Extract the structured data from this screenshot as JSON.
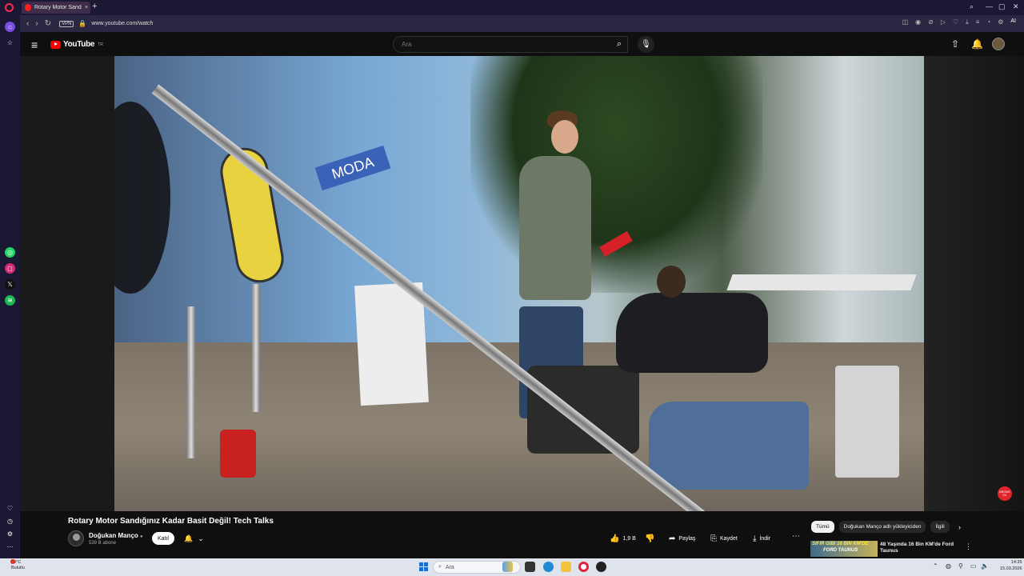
{
  "browser": {
    "tab_title": "Rotary Motor Sandığı",
    "tab_close": "×",
    "new_tab": "+",
    "url": "www.youtube.com/watch",
    "vpn_label": "VPN",
    "ai_label": "AI"
  },
  "youtube": {
    "logo_text": "YouTube",
    "logo_country": "TR",
    "search_placeholder": "Ara"
  },
  "video": {
    "title": "Rotary Motor Sandığınız Kadar Basit Değil! Tech Talks",
    "overlay_sign": "MODA",
    "watermark": "ABONE OL"
  },
  "channel": {
    "name": "Doğukan Manço",
    "verified_mark": "●",
    "subscribers": "539 B abone",
    "join_label": "Katıl"
  },
  "actions": {
    "likes": "1,9 B",
    "share": "Paylaş",
    "save": "Kaydet",
    "download": "İndir",
    "more": "⋯"
  },
  "recommendations": {
    "chips": [
      "Tümü",
      "Doğukan Manço adlı yükleyiciden",
      "İlgili"
    ],
    "items": [
      {
        "thumb_line1": "SIFIR GİBİ 16 BİN KM'DE",
        "thumb_line2": "FORD TAUNUS",
        "title": "48 Yaşında 16 Bin KM'de Ford Taunus"
      }
    ]
  },
  "taskbar": {
    "weather_temp": "10°C",
    "weather_desc": "Bulutlu",
    "search_label": "Ara",
    "time": "14:35",
    "date": "15.03.2026"
  },
  "colors": {
    "yt_red": "#ff0000",
    "page_bg": "#0f0f0f",
    "opera_sidebar": "#1b1833"
  }
}
